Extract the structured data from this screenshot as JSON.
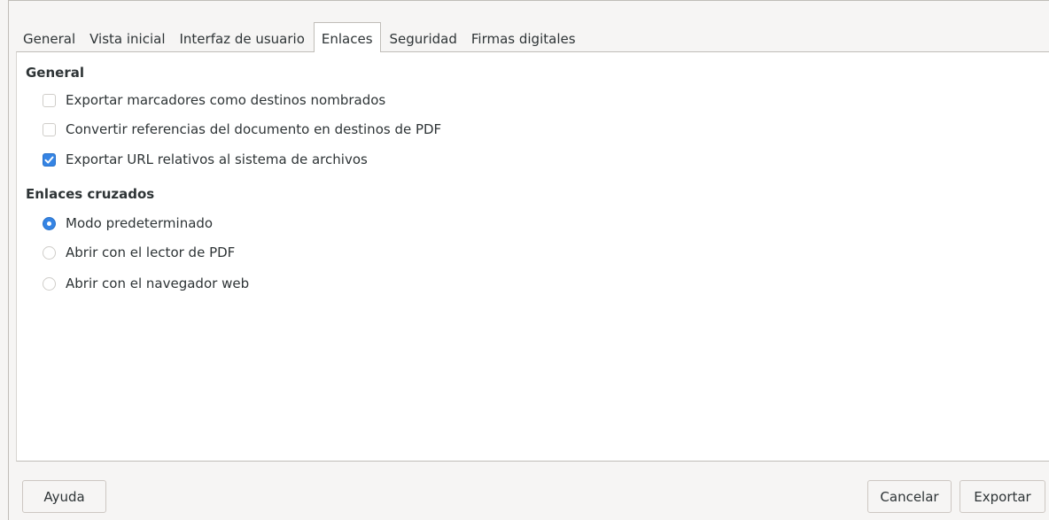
{
  "tabs": [
    "General",
    "Vista inicial",
    "Interfaz de usuario",
    "Enlaces",
    "Seguridad",
    "Firmas digitales"
  ],
  "active_tab": "Enlaces",
  "general": {
    "title": "General",
    "options": [
      {
        "label": "Exportar marcadores como destinos nombrados",
        "checked": false
      },
      {
        "label": "Convertir referencias del documento en destinos de PDF",
        "checked": false
      },
      {
        "label": "Exportar URL relativos al sistema de archivos",
        "checked": true
      }
    ]
  },
  "cross_links": {
    "title": "Enlaces cruzados",
    "options": [
      {
        "label": "Modo predeterminado",
        "selected": true
      },
      {
        "label": "Abrir con el lector de PDF",
        "selected": false
      },
      {
        "label": "Abrir con el navegador web",
        "selected": false
      }
    ]
  },
  "buttons": {
    "help": "Ayuda",
    "cancel": "Cancelar",
    "export": "Exportar"
  },
  "colors": {
    "accent": "#3584e4"
  }
}
